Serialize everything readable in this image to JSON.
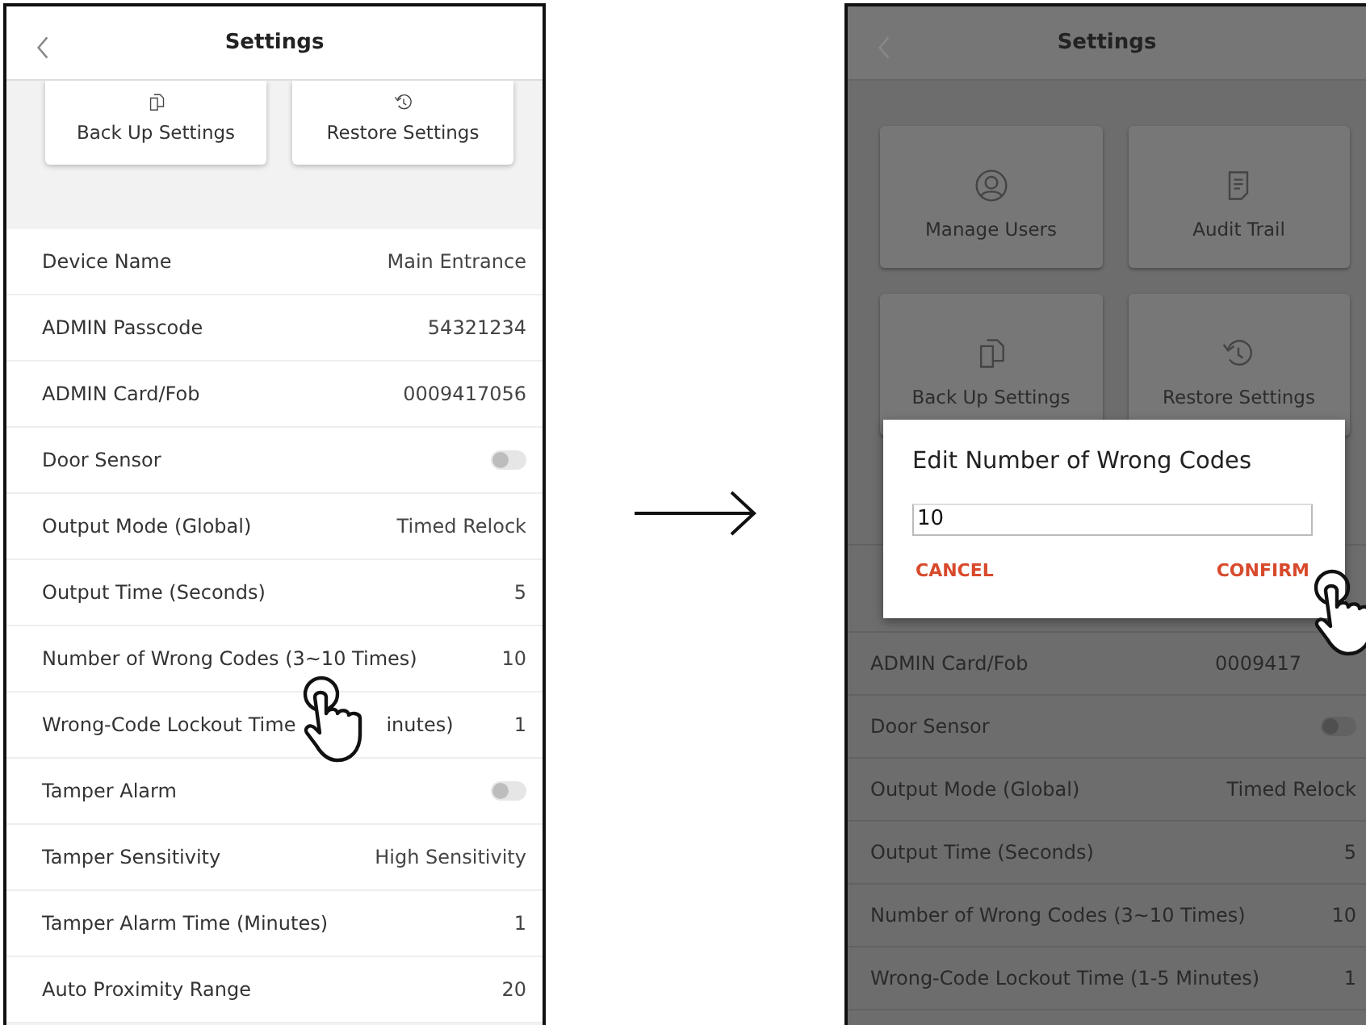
{
  "screens": [
    {
      "title": "Settings",
      "tiles": [
        {
          "label": "Back Up Settings"
        },
        {
          "label": "Restore Settings"
        }
      ],
      "rows": [
        {
          "kind": "text",
          "label": "Device Name",
          "value": "Main Entrance"
        },
        {
          "kind": "text",
          "label": "ADMIN Passcode",
          "value": "54321234"
        },
        {
          "kind": "text",
          "label": "ADMIN Card/Fob",
          "value": "0009417056"
        },
        {
          "kind": "toggle",
          "label": "Door Sensor",
          "on": false
        },
        {
          "kind": "text",
          "label": "Output Mode (Global)",
          "value": "Timed Relock"
        },
        {
          "kind": "text",
          "label": "Output Time (Seconds)",
          "value": "5"
        },
        {
          "kind": "text",
          "label": "Number of Wrong Codes (3~10 Times)",
          "value": "10"
        },
        {
          "kind": "split",
          "label": "Wrong-Code Lockout Time",
          "label_after": "inutes)",
          "value": "1"
        },
        {
          "kind": "toggle",
          "label": "Tamper Alarm",
          "on": false
        },
        {
          "kind": "text",
          "label": "Tamper Sensitivity",
          "value": "High Sensitivity"
        },
        {
          "kind": "text",
          "label": "Tamper Alarm Time (Minutes)",
          "value": "1"
        },
        {
          "kind": "text",
          "label": "Auto Proximity Range",
          "value": "20"
        }
      ]
    },
    {
      "title": "Settings",
      "tiles": [
        {
          "label": "Manage Users"
        },
        {
          "label": "Audit Trail"
        },
        {
          "label": "Back Up Settings"
        },
        {
          "label": "Restore Settings"
        }
      ],
      "rows": [
        {
          "kind": "hidden"
        },
        {
          "kind": "hidden"
        },
        {
          "kind": "text",
          "label": "ADMIN Card/Fob",
          "value": "0009417"
        },
        {
          "kind": "toggle",
          "label": "Door Sensor",
          "on": false
        },
        {
          "kind": "text",
          "label": "Output Mode (Global)",
          "value": "Timed Relock"
        },
        {
          "kind": "text",
          "label": "Output Time (Seconds)",
          "value": "5"
        },
        {
          "kind": "text",
          "label": "Number of Wrong Codes (3~10 Times)",
          "value": "10"
        },
        {
          "kind": "text",
          "label": "Wrong-Code Lockout Time (1-5 Minutes)",
          "value": "1"
        }
      ],
      "dialog": {
        "title": "Edit Number of Wrong Codes",
        "value": "10",
        "buttons": [
          "CANCEL",
          "CONFIRM"
        ]
      }
    }
  ]
}
